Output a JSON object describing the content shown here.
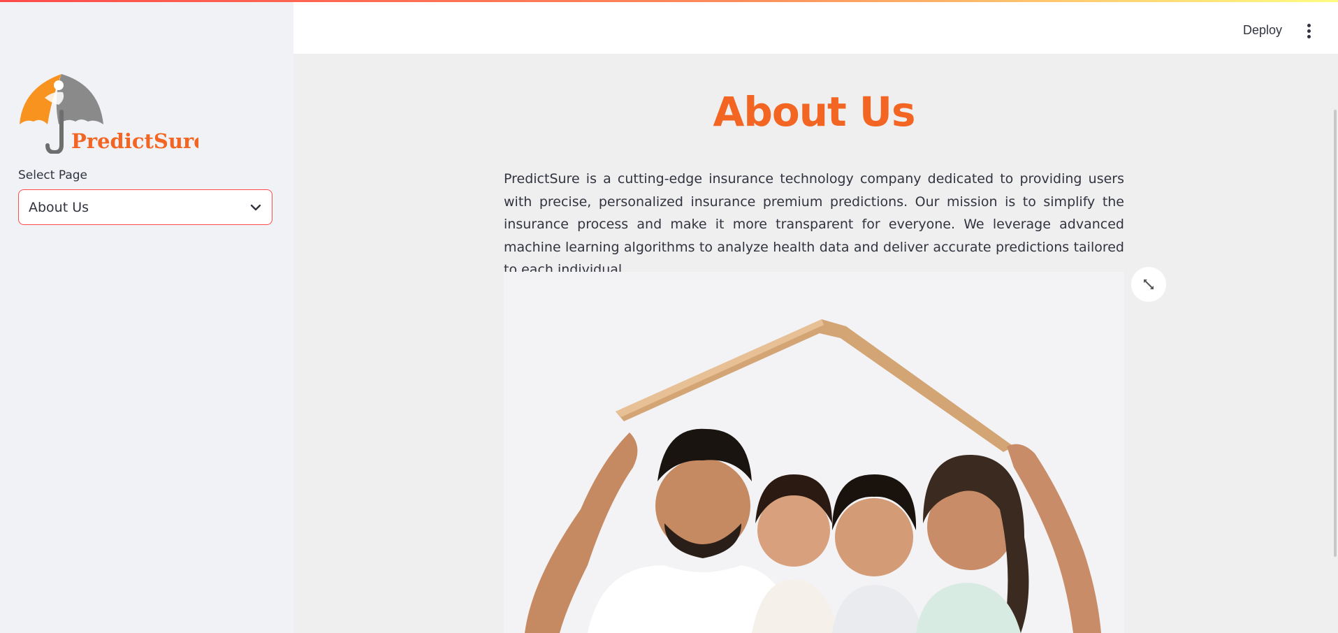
{
  "header": {
    "deploy_label": "Deploy",
    "menu_icon": "kebab-menu-icon"
  },
  "sidebar": {
    "logo_text": "PredictSure",
    "select_label": "Select Page",
    "select_value": "About Us",
    "select_icon": "chevron-down-icon"
  },
  "main": {
    "title": "About Us",
    "paragraph": "PredictSure is a cutting-edge insurance technology company dedicated to providing users with precise, personalized insurance premium predictions. Our mission is to simplify the insurance process and make it more transparent for everyone. We leverage advanced machine learning algorithms to analyze health data and deliver accurate predictions tailored to each individual.",
    "image_expand_icon": "fullscreen-expand-icon"
  },
  "colors": {
    "accent": "#f26522",
    "focus_border": "#ff4b4b",
    "sidebar_bg": "#f0f2f6",
    "main_bg": "#efefef",
    "text": "#31333f"
  }
}
